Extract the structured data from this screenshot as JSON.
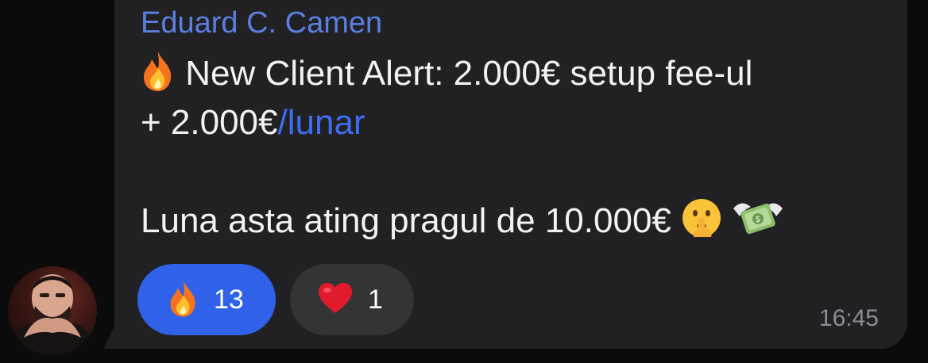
{
  "message": {
    "sender_name": "Eduard C. Camen",
    "line1_text": " New Client Alert: 2.000€ setup fee-ul",
    "line2_text": "+ 2.000€",
    "line2_link": "/lunar",
    "line3_text": "Luna asta ating pragul de 10.000€ ",
    "timestamp": "16:45",
    "leading_icon": "fire-emoji",
    "trailing_icons": [
      "shushing-face-emoji",
      "money-with-wings-emoji"
    ]
  },
  "reactions": [
    {
      "icon": "fire-emoji",
      "count": "13",
      "selected": true,
      "color": "#2f62e8"
    },
    {
      "icon": "red-heart-emoji",
      "count": "1",
      "selected": false,
      "color": "#343436"
    }
  ],
  "colors": {
    "bubble": "#212123",
    "sender": "#5b7fe0",
    "link": "#3f6df2",
    "text": "#f2f2f2",
    "timestamp": "#8d8d92"
  }
}
